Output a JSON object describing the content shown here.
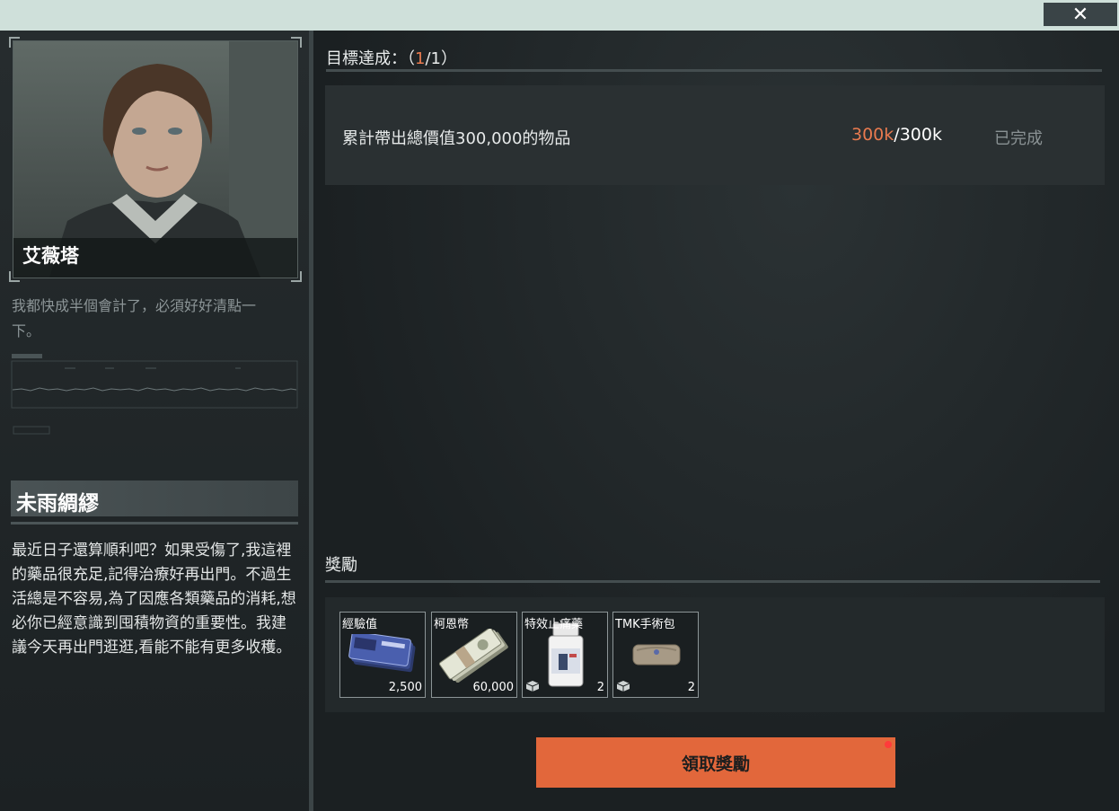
{
  "window": {
    "close_icon": "close-icon",
    "close_glyph": "✕"
  },
  "trader": {
    "name": "艾薇塔",
    "quote": "我都快成半個會計了，必須好好清點一下。"
  },
  "quest": {
    "title": "未雨綢繆",
    "description": "最近日子還算順利吧？如果受傷了,我這裡的藥品很充足,記得治療好再出門。不過生活總是不容易,為了因應各類藥品的消耗,想必你已經意識到囤積物資的重要性。我建議今天再出門逛逛,看能不能有更多收穫。"
  },
  "objectives": {
    "label": "目標達成：",
    "open": "（",
    "done": "1",
    "sep": "/",
    "total": "1",
    "close": "）",
    "items": [
      {
        "text": "累計帶出總價值300,000的物品",
        "current": "300k",
        "sep": "/",
        "target": "300k",
        "status": "已完成"
      }
    ]
  },
  "rewards": {
    "label": "獎勵",
    "items": [
      {
        "name": "經驗值",
        "count": "2,500",
        "icon": "exp-cards-icon"
      },
      {
        "name": "柯恩幣",
        "count": "60,000",
        "icon": "cash-stack-icon"
      },
      {
        "name": "特效止痛藥",
        "count": "2",
        "icon": "pill-bottle-icon"
      },
      {
        "name": "TMK手術包",
        "count": "2",
        "icon": "surgical-kit-icon"
      }
    ]
  },
  "claim_button": {
    "label": "領取獎勵"
  },
  "colors": {
    "accent": "#e87a4f",
    "button": "#e2673b",
    "notification_dot": "#ff3b3b",
    "topbar": "#cfe0da"
  }
}
